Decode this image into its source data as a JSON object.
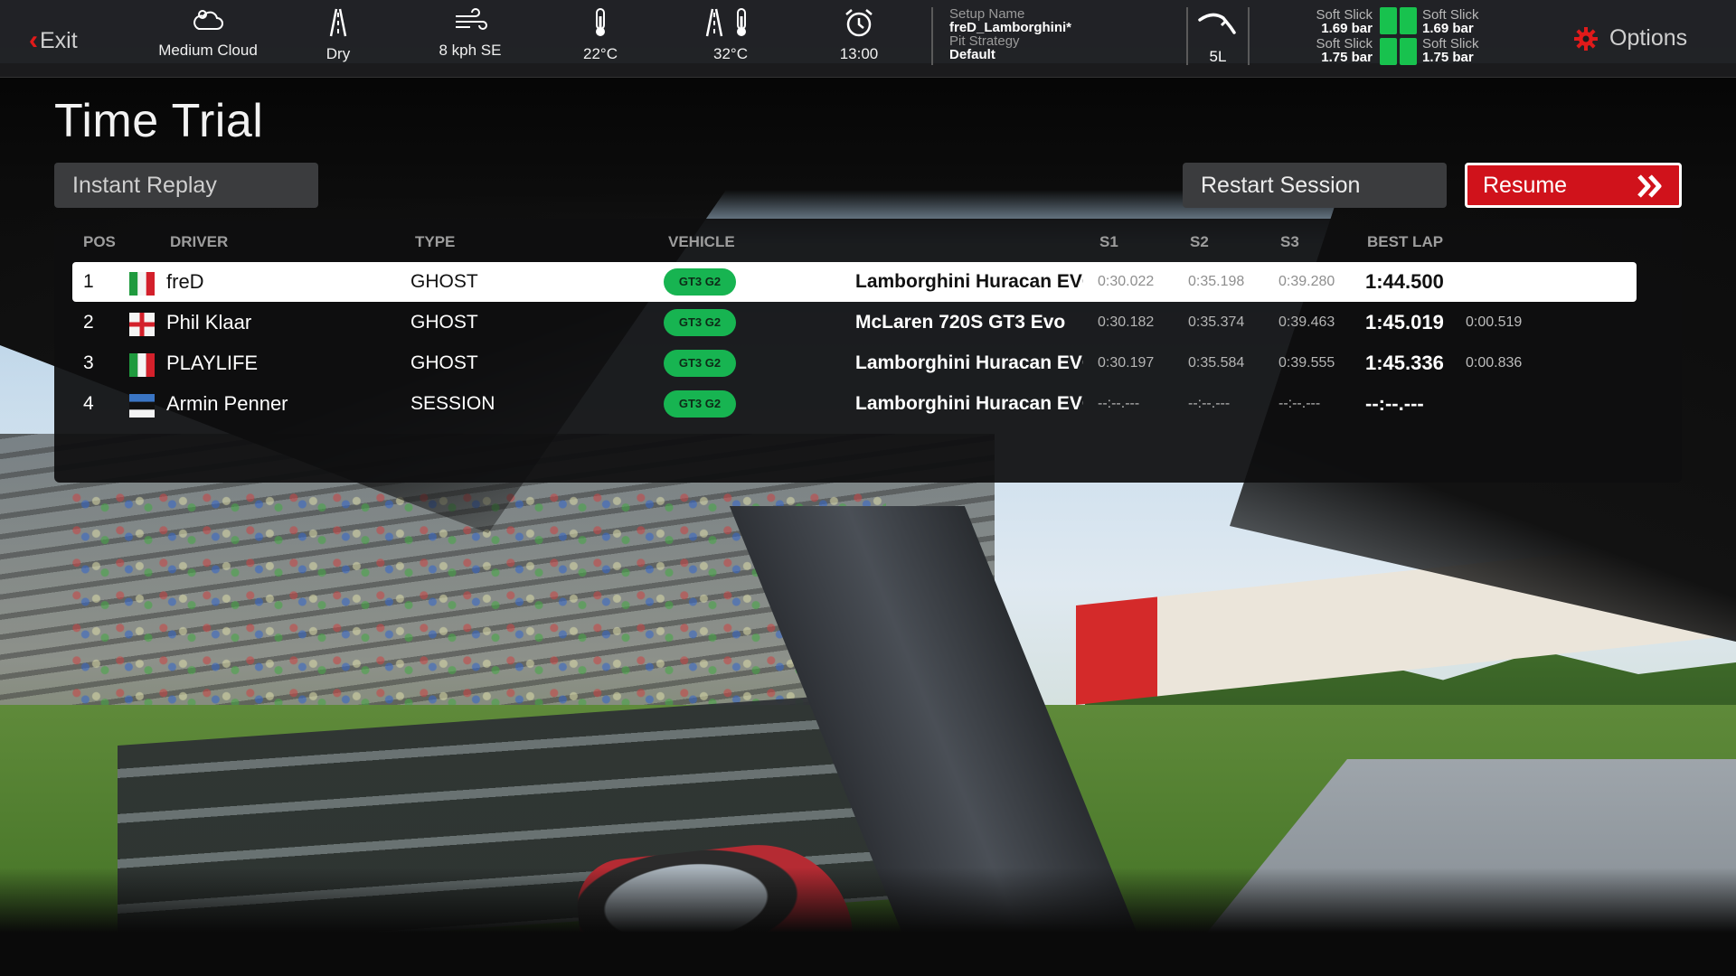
{
  "header": {
    "exit_label": "Exit",
    "options_label": "Options",
    "weather": [
      {
        "icon": "cloud-icon",
        "value": "Medium Cloud"
      },
      {
        "icon": "road-icon",
        "value": "Dry"
      },
      {
        "icon": "wind-icon",
        "value": "8 kph  SE"
      },
      {
        "icon": "thermometer-icon",
        "value": "22°C"
      },
      {
        "icon": "track-temperature-icon",
        "value": "32°C"
      },
      {
        "icon": "alarm-clock-icon",
        "value": "13:00"
      }
    ],
    "setup": {
      "setup_name_label": "Setup Name",
      "setup_name": "freD_Lamborghini*",
      "pit_strategy_label": "Pit Strategy",
      "pit_strategy": "Default"
    },
    "fuel": {
      "icon": "fuel-nozzle-icon",
      "value": "5L"
    },
    "tyres": {
      "color": "#18c24e",
      "front_left": {
        "compound": "Soft Slick",
        "pressure": "1.69 bar"
      },
      "front_right": {
        "compound": "Soft Slick",
        "pressure": "1.69 bar"
      },
      "rear_left": {
        "compound": "Soft Slick",
        "pressure": "1.75 bar"
      },
      "rear_right": {
        "compound": "Soft Slick",
        "pressure": "1.75 bar"
      }
    }
  },
  "session": {
    "title": "Time Trial",
    "instant_replay_label": "Instant Replay",
    "restart_label": "Restart Session",
    "resume_label": "Resume"
  },
  "colors": {
    "accent": "#d0121b",
    "class_badge": "#17b451",
    "panel": "#0e0e0f"
  },
  "table": {
    "columns": {
      "pos": "POS",
      "driver": "DRIVER",
      "type": "TYPE",
      "vehicle": "VEHICLE",
      "s1": "S1",
      "s2": "S2",
      "s3": "S3",
      "best_lap": "BEST LAP"
    },
    "rows": [
      {
        "pos": "1",
        "flag": "italy",
        "driver": "freD",
        "type": "GHOST",
        "class": "GT3 G2",
        "vehicle": "Lamborghini Huracan EVO",
        "s1": "0:30.022",
        "s2": "0:35.198",
        "s3": "0:39.280",
        "best": "1:44.500",
        "gap": "",
        "selected": true
      },
      {
        "pos": "2",
        "flag": "england",
        "driver": "Phil Klaar",
        "type": "GHOST",
        "class": "GT3 G2",
        "vehicle": "McLaren 720S GT3 Evo",
        "s1": "0:30.182",
        "s2": "0:35.374",
        "s3": "0:39.463",
        "best": "1:45.019",
        "gap": "0:00.519",
        "selected": false
      },
      {
        "pos": "3",
        "flag": "italy",
        "driver": "PLAYLIFE",
        "type": "GHOST",
        "class": "GT3 G2",
        "vehicle": "Lamborghini Huracan EVO",
        "s1": "0:30.197",
        "s2": "0:35.584",
        "s3": "0:39.555",
        "best": "1:45.336",
        "gap": "0:00.836",
        "selected": false
      },
      {
        "pos": "4",
        "flag": "estonia",
        "driver": "Armin Penner",
        "type": "SESSION",
        "class": "GT3 G2",
        "vehicle": "Lamborghini Huracan EVO",
        "s1": "--:--.---",
        "s2": "--:--.---",
        "s3": "--:--.---",
        "best": "--:--.---",
        "gap": "",
        "selected": false
      }
    ]
  }
}
